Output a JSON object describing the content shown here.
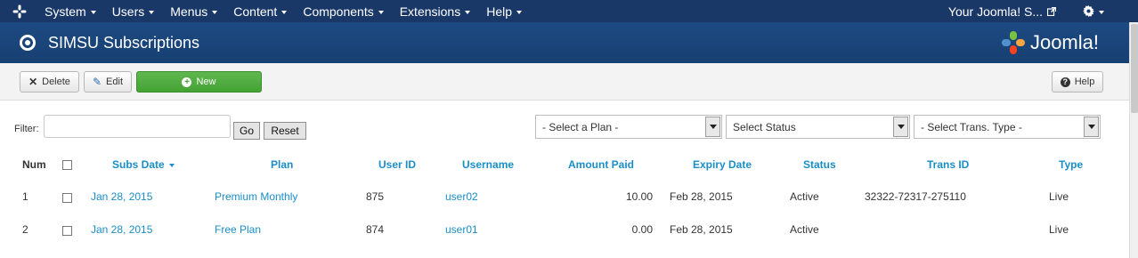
{
  "navbar": {
    "menus": [
      "System",
      "Users",
      "Menus",
      "Content",
      "Components",
      "Extensions",
      "Help"
    ],
    "site_link": "Your Joomla! S...",
    "icons": [
      "joomla-logo-icon",
      "external-link-icon",
      "gear-icon"
    ]
  },
  "header": {
    "title": "SIMSU Subscriptions",
    "brand": "Joomla!"
  },
  "toolbar": {
    "delete_label": "Delete",
    "edit_label": "Edit",
    "new_label": "New",
    "help_label": "Help",
    "colors": {
      "new_button": "#47a437"
    }
  },
  "filters": {
    "filter_label": "Filter:",
    "filter_value": "",
    "go_label": "Go",
    "reset_label": "Reset",
    "plan_select": "- Select a Plan -",
    "status_select": "Select Status",
    "trans_type_select": "- Select Trans. Type -"
  },
  "table": {
    "headers": {
      "num": "Num",
      "subs_date": "Subs Date",
      "plan": "Plan",
      "user_id": "User ID",
      "username": "Username",
      "amount_paid": "Amount Paid",
      "expiry_date": "Expiry Date",
      "status": "Status",
      "trans_id": "Trans ID",
      "type": "Type"
    },
    "rows": [
      {
        "num": "1",
        "subs_date": "Jan 28, 2015",
        "plan": "Premium Monthly",
        "user_id": "875",
        "username": "user02",
        "amount_paid": "10.00",
        "expiry_date": "Feb 28, 2015",
        "status": "Active",
        "trans_id": "32322-72317-275110",
        "type": "Live"
      },
      {
        "num": "2",
        "subs_date": "Jan 28, 2015",
        "plan": "Free Plan",
        "user_id": "874",
        "username": "user01",
        "amount_paid": "0.00",
        "expiry_date": "Feb 28, 2015",
        "status": "Active",
        "trans_id": "",
        "type": "Live"
      }
    ]
  }
}
